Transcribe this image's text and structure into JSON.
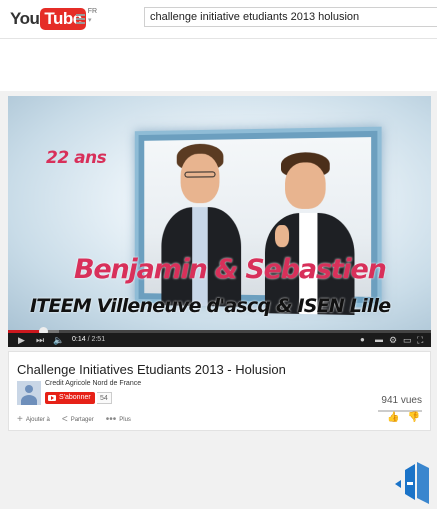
{
  "header": {
    "logo_you": "You",
    "logo_tube": "Tube",
    "logo_region": "FR",
    "search_value": "challenge initiative etudiants 2013 holusion"
  },
  "player": {
    "overlay_age": "22 ans",
    "overlay_names": "Benjamin & Sebastien",
    "overlay_schools": "ITEEM Villeneuve d'ascq & ISEN Lille",
    "time_current": "0:14",
    "time_separator": " / ",
    "time_total": "2:51",
    "progress_fraction": 0.082,
    "loaded_fraction": 0.12
  },
  "info": {
    "title": "Challenge Initiatives Etudiants 2013 - Holusion",
    "channel": "Credit Agricole Nord de France",
    "subscribe_label": "S'abonner",
    "subscriber_count": "54",
    "views": "941 vues",
    "actions": {
      "add_label": "Ajouter à",
      "share_label": "Partager",
      "more_label": "Plus"
    }
  },
  "colors": {
    "brand_red": "#e52d27",
    "overlay_pink": "#d8305a",
    "subscribe_red": "#e62117",
    "badge_blue": "#1a73c8"
  }
}
